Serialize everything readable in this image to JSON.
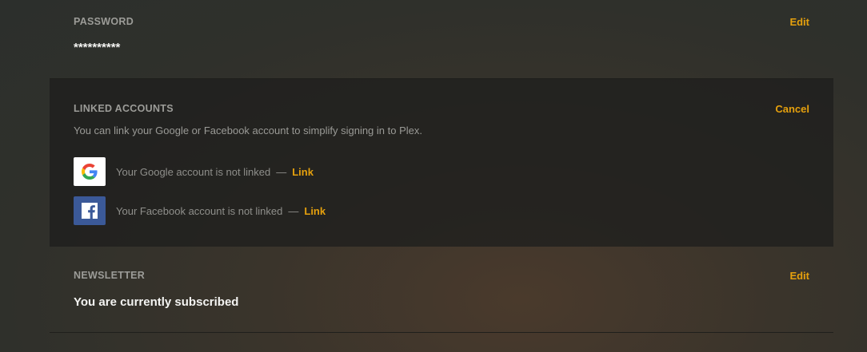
{
  "password": {
    "label": "PASSWORD",
    "action": "Edit",
    "value": "**********"
  },
  "linked_accounts": {
    "label": "LINKED ACCOUNTS",
    "action": "Cancel",
    "description": "You can link your Google or Facebook account to simplify signing in to Plex.",
    "separator": "—",
    "accounts": [
      {
        "icon": "google-icon",
        "text": "Your Google account is not linked",
        "link": "Link"
      },
      {
        "icon": "facebook-icon",
        "text": "Your Facebook account is not linked",
        "link": "Link"
      }
    ]
  },
  "newsletter": {
    "label": "NEWSLETTER",
    "action": "Edit",
    "value": "You are currently subscribed"
  },
  "colors": {
    "accent": "#e5a00d",
    "facebook_blue": "#3b5998"
  }
}
